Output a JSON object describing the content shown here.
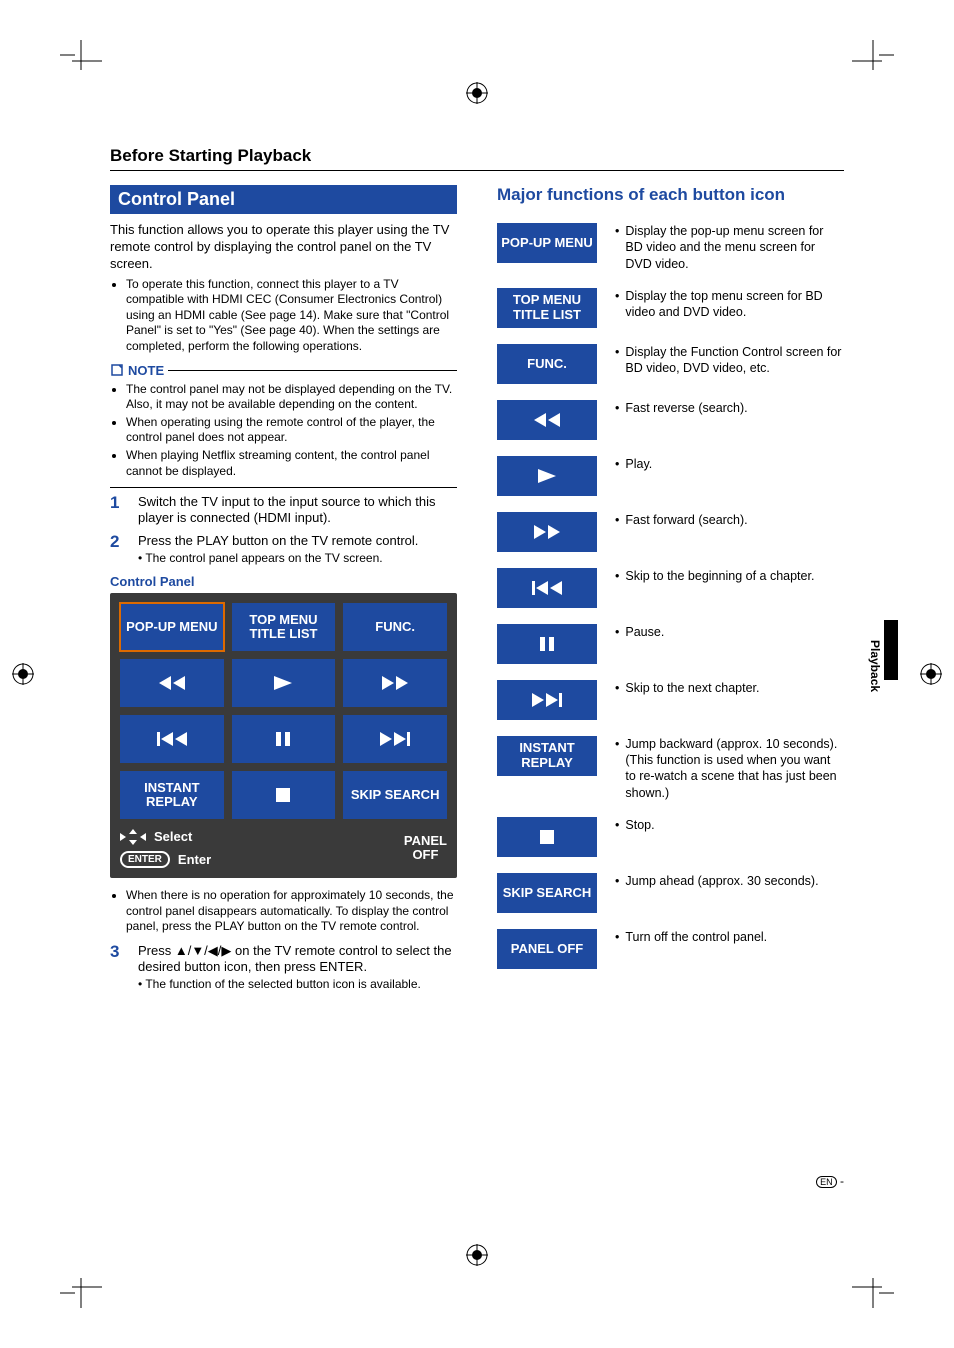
{
  "chapter": "Before Starting Playback",
  "side_tab": "Playback",
  "left": {
    "section_title": "Control Panel",
    "intro": "This function allows you to operate this player using the TV remote control by displaying the control panel on the TV screen.",
    "intro_bullet": "To operate this function, connect this player to a TV compatible with HDMI CEC (Consumer Electronics Control) using an HDMI cable (See page 14). Make sure that \"Control Panel\" is set to \"Yes\" (See page 40). When the settings are completed, perform the following operations.",
    "note_label": "NOTE",
    "notes": [
      "The control panel may not be displayed depending on the TV. Also, it may not be available depending on the content.",
      "When operating using the remote control of the player, the control panel does not appear.",
      "When playing Netflix streaming content, the control panel cannot be displayed."
    ],
    "steps": [
      {
        "num": "1",
        "text": "Switch the TV input to the input source to which this player is connected (HDMI input)."
      },
      {
        "num": "2",
        "text": "Press the PLAY button on the TV remote control.",
        "sub": "The control panel appears on the TV screen."
      },
      {
        "num": "3",
        "text": "Press ▲/▼/◀/▶ on the TV remote control to select the desired button icon, then press ENTER.",
        "sub": "The function of the selected button icon is available."
      }
    ],
    "panel_label": "Control Panel",
    "panel_note": "When there is no operation for approximately 10 seconds, the control panel disappears automatically. To display the control panel, press the PLAY button on the TV remote control."
  },
  "panel": {
    "buttons": [
      "POP-UP MENU",
      "TOP MENU TITLE LIST",
      "FUNC.",
      "INSTANT REPLAY",
      "SKIP SEARCH"
    ],
    "foot": {
      "select": "Select",
      "enter_pill": "ENTER",
      "enter": "Enter",
      "off1": "PANEL",
      "off2": "OFF"
    }
  },
  "right": {
    "heading": "Major functions of each button icon",
    "rows": [
      {
        "label": "POP-UP MENU",
        "desc": "Display the pop-up menu screen for BD video and the menu screen for DVD video."
      },
      {
        "label": "TOP MENU TITLE LIST",
        "desc": "Display the top menu screen for BD video and DVD video."
      },
      {
        "label": "FUNC.",
        "desc": "Display the Function Control screen for BD video, DVD video, etc."
      },
      {
        "label": "",
        "desc": "Fast reverse (search)."
      },
      {
        "label": "",
        "desc": "Play."
      },
      {
        "label": "",
        "desc": "Fast forward (search)."
      },
      {
        "label": "",
        "desc": "Skip to the beginning of a chapter."
      },
      {
        "label": "",
        "desc": "Pause."
      },
      {
        "label": "",
        "desc": "Skip to the next chapter."
      },
      {
        "label": "INSTANT REPLAY",
        "desc": "Jump backward (approx. 10 seconds). (This function is used when you want to re-watch a scene that has just been shown.)"
      },
      {
        "label": "",
        "desc": "Stop."
      },
      {
        "label": "SKIP SEARCH",
        "desc": "Jump ahead (approx. 30 seconds)."
      },
      {
        "label": "PANEL OFF",
        "desc": "Turn off the control panel."
      }
    ]
  },
  "footer": {
    "lang": "EN",
    "suffix": " -"
  }
}
